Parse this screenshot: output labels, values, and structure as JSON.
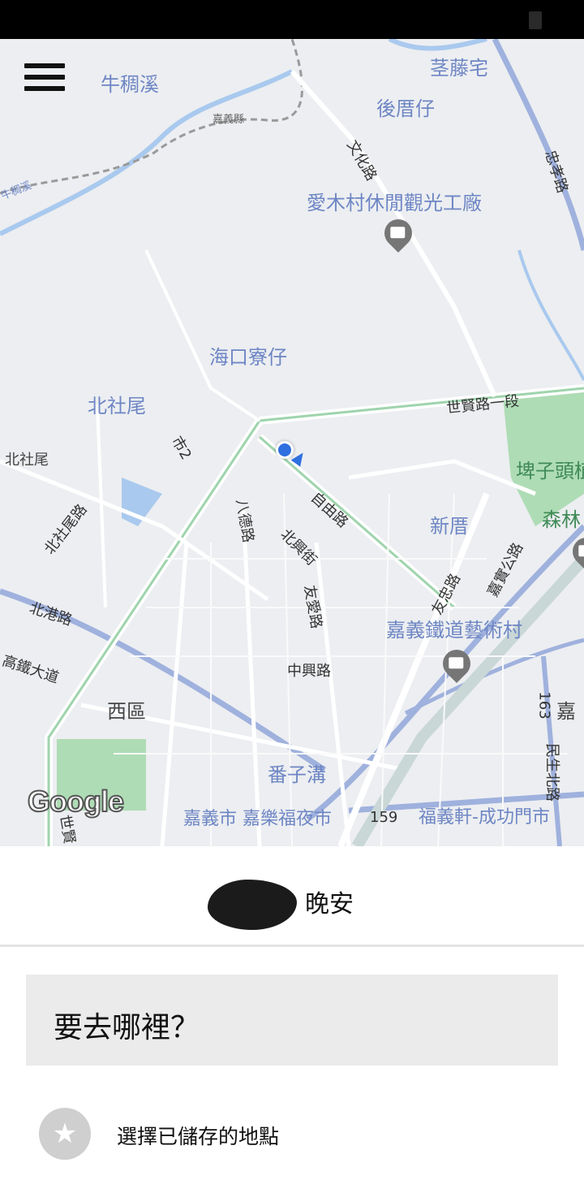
{
  "map": {
    "labels": {
      "niuchouxi": "牛稠溪",
      "luotengzhai": "茎藤宅",
      "houcuozai": "後厝仔",
      "jiayixian": "嘉義縣",
      "niuchouxi_small": "牛稠溪",
      "wenhualu": "文化路",
      "zhongxiaolu": "忠孝路",
      "aimucun": "愛木村休閒觀光工廠",
      "haikouliaozai": "海口寮仔",
      "beisheiwei": "北社尾",
      "beisheiwei_small": "北社尾",
      "shi2": "市2",
      "shixianlu": "世賢路一段",
      "ziyoulu": "自由路",
      "badelu": "八德路",
      "beixingjie": "北興街",
      "beisheiweilu": "北社尾路",
      "xincuo": "新厝",
      "pizitou": "埤子頭植",
      "senlin": "森林",
      "jiaguanlu": "嘉實公路",
      "zhongxiaolu2": "友忠路",
      "youailu": "友愛路",
      "beiganglu": "北港路",
      "jiayitielu": "嘉義鐵道藝術村",
      "gaotiedadao": "高鐵大道",
      "zhongxinglu": "中興路",
      "xiqu": "西區",
      "route163": "163",
      "jia": "嘉",
      "minshengbeilu": "民生北路",
      "fanzigou": "番子溝",
      "jiayishi": "嘉義市 嘉樂福夜市",
      "route159": "159",
      "fuyixuan": "福義軒-成功門市",
      "shixian_bottom": "世賢"
    },
    "google": "Google"
  },
  "greeting": {
    "text": "晚安"
  },
  "search": {
    "placeholder": "要去哪裡？"
  },
  "saved_places": {
    "label": "選擇已儲存的地點",
    "icon": "star-icon"
  }
}
